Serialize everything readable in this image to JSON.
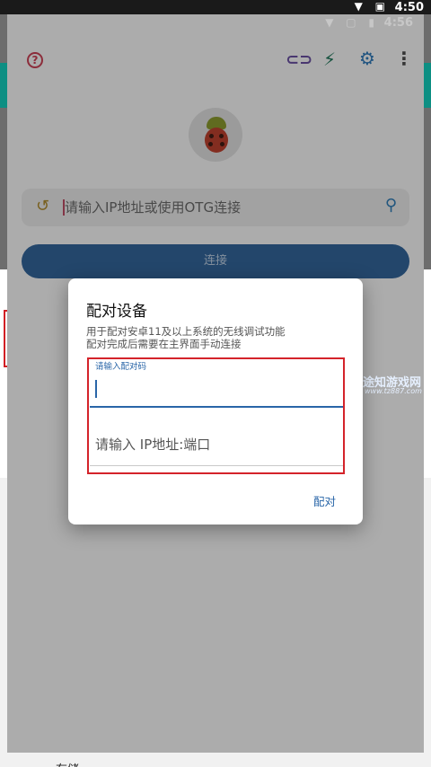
{
  "outer_status": {
    "time": "4:50",
    "icons": "▼ ▣"
  },
  "inner_status": {
    "time": "4:56",
    "icons": "▼ ▢ ▮"
  },
  "toolbar": {
    "help_icon": "?",
    "link_icon": "⊂⊃",
    "bolt_icon": "⚡",
    "gear_icon": "⚙",
    "more_icon": "⋮"
  },
  "search": {
    "placeholder": "请输入IP地址或使用OTG连接",
    "history_icon": "↺",
    "search_icon": "⚲"
  },
  "connect_button": "连接",
  "dialog": {
    "title": "配对设备",
    "description_line1": "用于配对安卓11及以上系统的无线调试功能",
    "description_line2": "配对完成后需要在主界面手动连接",
    "pair_code_label": "请输入配对码",
    "ip_port_placeholder": "请输入 IP地址:端口",
    "pair_button": "配对"
  },
  "watermark": {
    "text": "途知游戏网",
    "url": "www.tz887.com"
  },
  "bottom_label": "存储",
  "device_card": {
    "phone_icon": "▯",
    "chevron": "›"
  },
  "colors": {
    "accent": "#2a66a8",
    "teal": "#0d8f83",
    "highlight_red": "#d4232a"
  }
}
